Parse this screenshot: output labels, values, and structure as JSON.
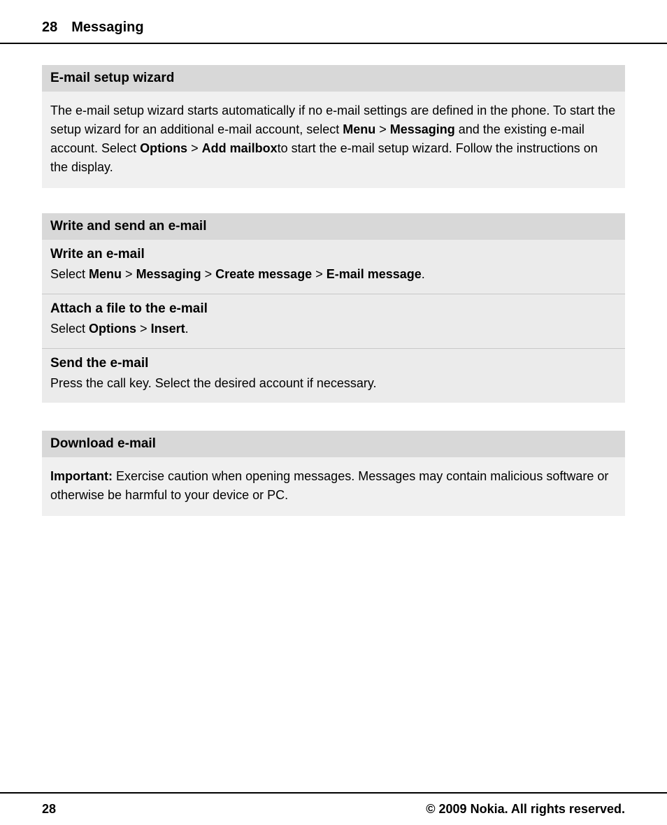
{
  "header": {
    "page_number": "28",
    "title": "Messaging"
  },
  "sections": [
    {
      "id": "email-setup-wizard",
      "heading": "E-mail setup wizard",
      "body": "The e-mail setup wizard starts automatically if no e-mail settings are defined in the phone. To start the setup wizard for an additional e-mail account, select",
      "body_bold1": "Menu",
      "body_mid1": "> ",
      "body_bold2": "Messaging",
      "body_mid2": "and the existing e-mail account. Select",
      "body_bold3": "Options",
      "body_mid3": "> ",
      "body_bold4": "Add mailbox",
      "body_end": "to start the e-mail setup wizard. Follow the instructions on the display."
    },
    {
      "id": "write-send-email",
      "heading": "Write and send an e-mail",
      "subsections": [
        {
          "id": "write-email",
          "title": "Write an e-mail",
          "body_pre": "Select",
          "body_bold1": "Menu",
          "body_mid1": ">",
          "body_bold2": "Messaging",
          "body_mid2": ">",
          "body_bold3": "Create message",
          "body_mid3": ">",
          "body_bold4": "E-mail message",
          "body_end": "."
        },
        {
          "id": "attach-file",
          "title": "Attach a file to the e-mail",
          "body_pre": "Select",
          "body_bold1": "Options",
          "body_mid1": ">",
          "body_bold2": "Insert",
          "body_end": "."
        },
        {
          "id": "send-email",
          "title": "Send the e-mail",
          "body": "Press the call key. Select the desired account if necessary."
        }
      ]
    },
    {
      "id": "download-email",
      "heading": "Download e-mail",
      "body_bold": "Important:",
      "body": "  Exercise caution when opening messages. Messages may contain malicious software or otherwise be harmful to your device or PC."
    }
  ],
  "footer": {
    "page_number": "28",
    "copyright": "© 2009 Nokia. All rights reserved."
  }
}
